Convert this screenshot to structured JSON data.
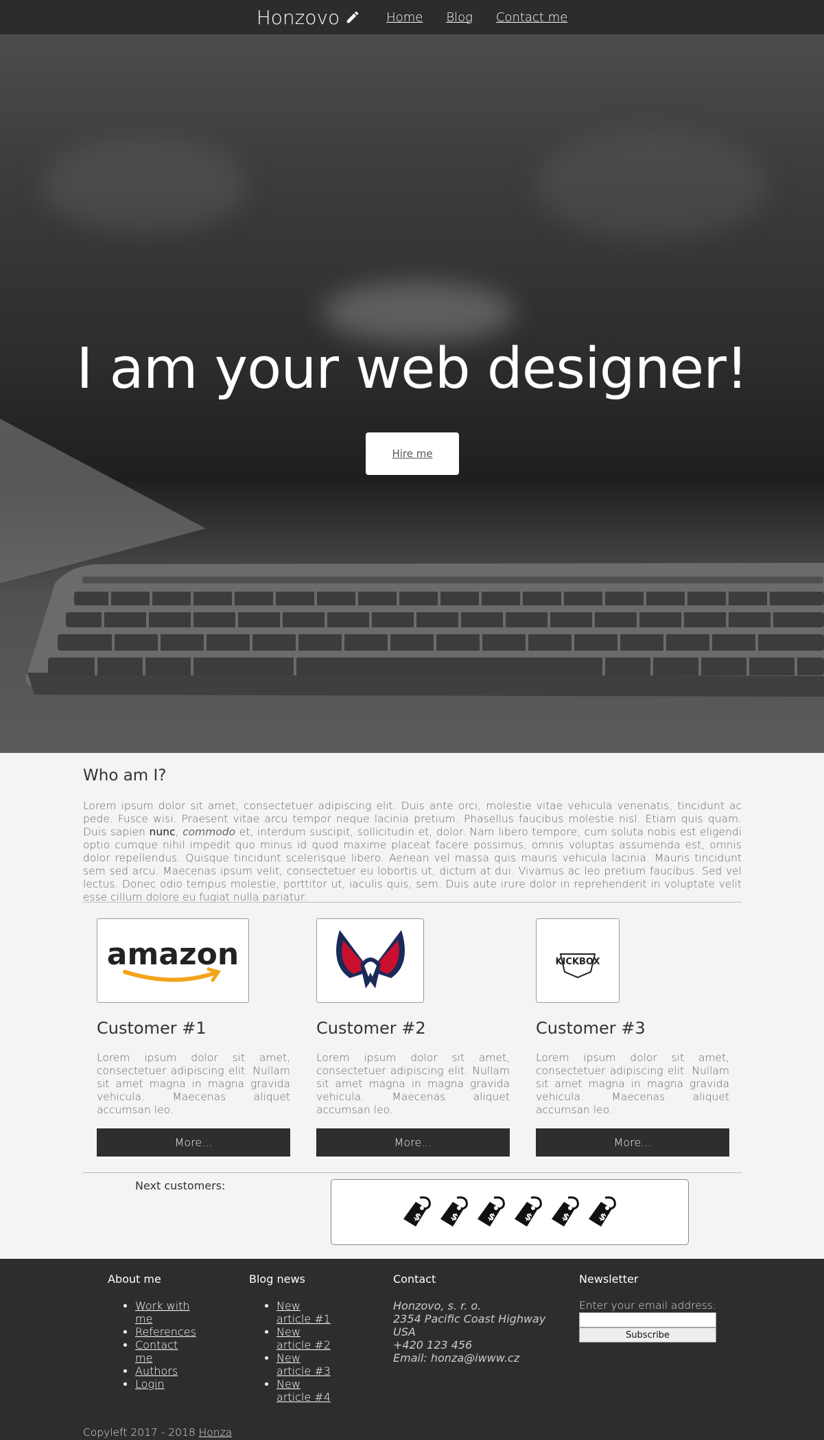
{
  "header": {
    "brand": "Honzovo",
    "nav": [
      "Home",
      "Blog",
      "Contact me"
    ]
  },
  "hero": {
    "title": "I am your web designer!",
    "button": "Hire me"
  },
  "about": {
    "title": "Who am I?",
    "text_1": "Lorem ipsum dolor sit amet, consectetuer adipiscing elit. Duis ante orci, molestie vitae vehicula venenatis, tincidunt ac pede. Fusce wisi. Praesent vitae arcu tempor neque lacinia pretium. Phasellus faucibus molestie nisl. Etiam quis quam. Duis sapien ",
    "bold": "nunc",
    "comma": ", ",
    "italic": "commodo",
    "text_2": " et, ",
    "link": "interdum",
    "text_3": " suscipit, sollicitudin et, dolor. Nam libero tempore, cum soluta nobis est eligendi optio cumque nihil impedit quo minus id quod maxime placeat facere possimus, omnis voluptas assumenda est, omnis dolor repellendus. Quisque tincidunt scelerisque libero. Aenean vel massa quis mauris vehicula lacinia. Mauris tincidunt sem sed arcu. Maecenas ipsum velit, consectetuer eu lobortis ut, dictum at dui. Vivamus ac leo pretium faucibus. Sed vel lectus. Donec odio tempus molestie, porttitor ut, iaculis quis, sem. Duis aute irure dolor in reprehenderit in voluptate velit esse cillum dolore eu fugiat nulla pariatur."
  },
  "customers": [
    {
      "title": "Customer #1",
      "logo": "amazon",
      "logo_text": "amazon",
      "text": "Lorem ipsum dolor sit amet, consectetuer adipiscing elit. Nullam sit amet magna in magna gravida vehicula. Maecenas aliquet accumsan leo.",
      "button": "More..."
    },
    {
      "title": "Customer #2",
      "logo": "eagle-wings",
      "text": "Lorem ipsum dolor sit amet, consectetuer adipiscing elit. Nullam sit amet magna in magna gravida vehicula. Maecenas aliquet accumsan leo.",
      "button": "More..."
    },
    {
      "title": "Customer #3",
      "logo": "kickbox",
      "logo_text": "KICKBOX",
      "text": "Lorem ipsum dolor sit amet, consectetuer adipiscing elit. Nullam sit amet magna in magna gravida vehicula. Maecenas aliquet accumsan leo.",
      "button": "More..."
    }
  ],
  "next_customers": {
    "label": "Next customers:",
    "icon": "price-tag-icon"
  },
  "footer": {
    "about": {
      "title": "About me",
      "links": [
        "Work with me",
        "References",
        "Contact me",
        "Authors",
        "Login"
      ]
    },
    "blog": {
      "title": "Blog news",
      "links": [
        "New article #1",
        "New article #2",
        "New article #3",
        "New article #4"
      ]
    },
    "contact": {
      "title": "Contact",
      "lines": [
        "Honzovo, s. r. o.",
        "2354 Pacific Coast Highway",
        "USA",
        "+420 123 456"
      ],
      "email_label": "Email: ",
      "email": "honza@iwww.cz"
    },
    "newsletter": {
      "title": "Newsletter",
      "label": "Enter your email address:",
      "input_value": "",
      "button": "Subscribe"
    },
    "copyright": "Copyleft 2017 - 2018 ",
    "copyright_link": "Honza"
  },
  "colors": {
    "header_bg": "#2c2c2c",
    "page_bg": "#f4f4f4",
    "button_bg": "#2e2e2e",
    "footer_bg": "#2d2d2d"
  }
}
